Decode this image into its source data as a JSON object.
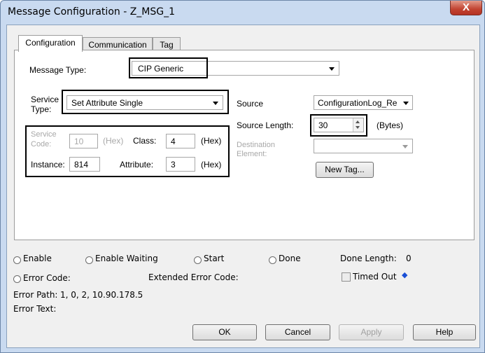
{
  "window": {
    "title": "Message Configuration - Z_MSG_1",
    "close_glyph": "X"
  },
  "tabs": [
    {
      "label": "Configuration",
      "active": true
    },
    {
      "label": "Communication",
      "active": false
    },
    {
      "label": "Tag",
      "active": false
    }
  ],
  "config": {
    "message_type_label": "Message Type:",
    "message_type_value": "CIP Generic",
    "service_type_label_1": "Service",
    "service_type_label_2": "Type:",
    "service_type_value": "Set Attribute Single",
    "service_code_label_1": "Service",
    "service_code_label_2": "Code:",
    "service_code_value": "10",
    "service_code_unit": "(Hex)",
    "class_label": "Class:",
    "class_value": "4",
    "class_unit": "(Hex)",
    "instance_label": "Instance:",
    "instance_value": "814",
    "attribute_label": "Attribute:",
    "attribute_value": "3",
    "attribute_unit": "(Hex)",
    "source_label": "Source",
    "source_value": "ConfigurationLog_Re",
    "source_length_label": "Source Length:",
    "source_length_value": "30",
    "source_length_unit": "(Bytes)",
    "destination_label_1": "Destination",
    "destination_label_2": "Element:",
    "destination_value": "",
    "new_tag_button": "New Tag..."
  },
  "status": {
    "enable": "Enable",
    "enable_waiting": "Enable Waiting",
    "start": "Start",
    "done": "Done",
    "done_length_label": "Done Length:",
    "done_length_value": "0",
    "error_code_label": "Error Code:",
    "extended_error_code_label": "Extended Error Code:",
    "timed_out_label": "Timed Out",
    "timed_out_arrow": "◆",
    "error_path_label": "Error Path:",
    "error_path_value": "1, 0, 2, 10.90.178.5",
    "error_text_label": "Error Text:"
  },
  "buttons": {
    "ok": "OK",
    "cancel": "Cancel",
    "apply": "Apply",
    "help": "Help"
  },
  "colors": {
    "highlight_frame": "#000000",
    "timed_out_arrow": "#1a4fd6"
  }
}
